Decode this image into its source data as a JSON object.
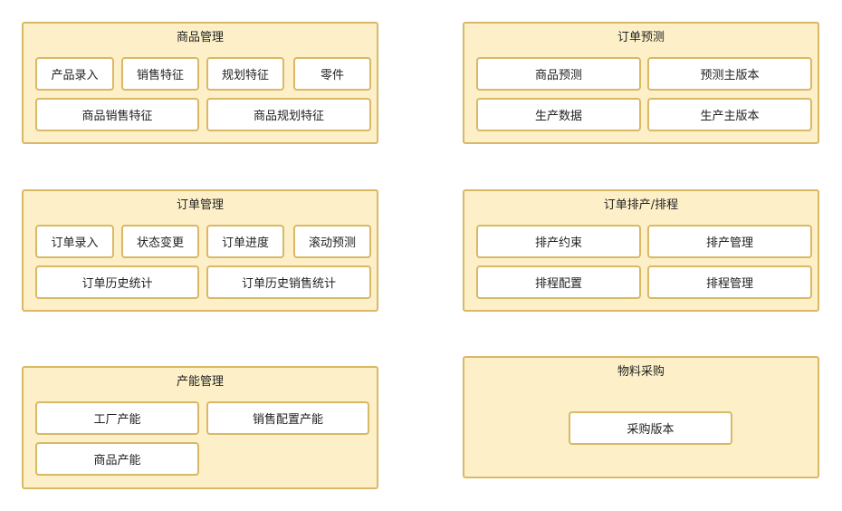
{
  "panels": {
    "product_management": {
      "title": "商品管理",
      "items": [
        "产品录入",
        "销售特征",
        "规划特征",
        "零件",
        "商品销售特征",
        "商品规划特征"
      ]
    },
    "order_forecast": {
      "title": "订单预测",
      "items": [
        "商品预测",
        "预测主版本",
        "生产数据",
        "生产主版本"
      ]
    },
    "order_management": {
      "title": "订单管理",
      "items": [
        "订单录入",
        "状态变更",
        "订单进度",
        "滚动预测",
        "订单历史统计",
        "订单历史销售统计"
      ]
    },
    "order_scheduling": {
      "title": "订单排产/排程",
      "items": [
        "排产约束",
        "排产管理",
        "排程配置",
        "排程管理"
      ]
    },
    "capacity_management": {
      "title": "产能管理",
      "items": [
        "工厂产能",
        "销售配置产能",
        "商品产能"
      ]
    },
    "material_procurement": {
      "title": "物料采购",
      "items": [
        "采购版本"
      ]
    }
  }
}
